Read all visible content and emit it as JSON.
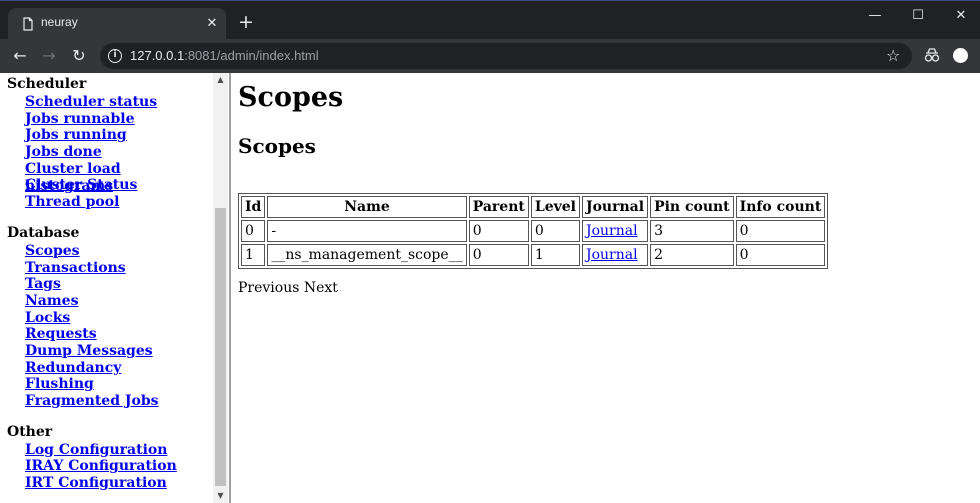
{
  "browser": {
    "tab_title": "neuray",
    "tab_close": "✕",
    "new_tab": "+",
    "window_controls": [
      "—",
      "☐",
      "✕"
    ],
    "url_host": "127.0.0.1",
    "url_rest": ":8081/admin/index.html",
    "icons": [
      "page-icon",
      "back-arrow-icon",
      "forward-arrow-icon",
      "reload-icon",
      "info-icon",
      "star-icon",
      "extension-icon",
      "profile-icon"
    ]
  },
  "sidebar": {
    "sections": [
      {
        "title": "Scheduler",
        "items": [
          "Scheduler status",
          "Jobs runnable",
          "Jobs running",
          "Jobs done",
          "Cluster load histograms",
          "Cluster Status",
          "Thread pool"
        ]
      },
      {
        "title": "Database",
        "items": [
          "Scopes",
          "Transactions",
          "Tags",
          "Names",
          "Locks",
          "Requests",
          "Dump Messages",
          "Redundancy",
          "Flushing",
          "Fragmented Jobs"
        ]
      },
      {
        "title": "Other",
        "items": [
          "Log Configuration",
          "IRAY Configuration",
          "IRT Configuration"
        ]
      }
    ]
  },
  "main": {
    "title": "Scopes",
    "subtitle": "Scopes",
    "table": {
      "headers": [
        "Id",
        "Name",
        "Parent",
        "Level",
        "Journal",
        "Pin count",
        "Info count"
      ],
      "rows": [
        [
          "0",
          "-",
          "0",
          "0",
          "Journal",
          "3",
          "0"
        ],
        [
          "1",
          "__ns_management_scope__",
          "0",
          "1",
          "Journal",
          "2",
          "0"
        ]
      ]
    },
    "pager": {
      "previous": "Previous",
      "next": "Next"
    }
  },
  "colors": {
    "titlebar": "#202124",
    "toolbar": "#35363a",
    "link": "#0000ee",
    "scroll_thumb": "#c1c1c1"
  }
}
